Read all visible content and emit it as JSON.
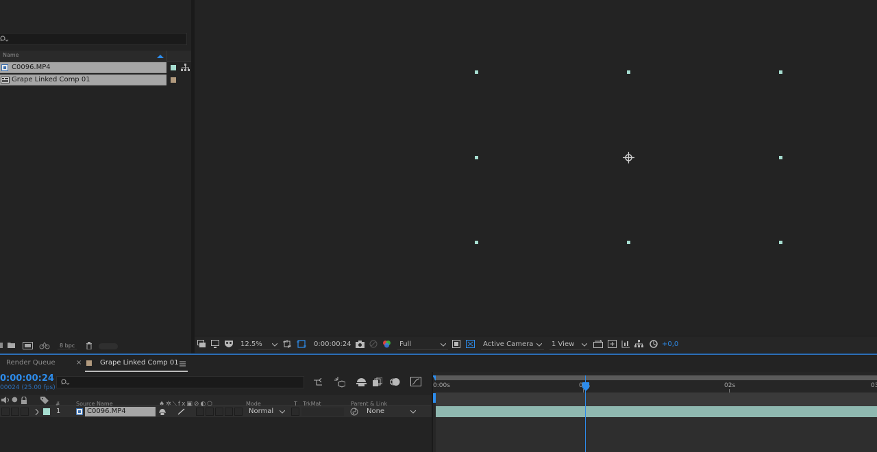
{
  "project": {
    "column_name": "Name",
    "items": [
      {
        "name": "C0096.MP4",
        "label_color": "#a6ddd0",
        "icon": "footage-icon"
      },
      {
        "name": "Grape  Linked Comp 01",
        "label_color": "#b29a7e",
        "icon": "composition-icon"
      }
    ],
    "footer": {
      "bpc": "8 bpc"
    }
  },
  "viewer": {
    "toolbar": {
      "zoom": "12.5%",
      "timecode": "0:00:00:24",
      "resolution": "Full",
      "camera": "Active Camera",
      "views": "1 View",
      "exposure": "+0,0"
    }
  },
  "timeline": {
    "tabs": [
      {
        "label": "Render Queue",
        "active": false
      },
      {
        "label": "Grape  Linked Comp 01",
        "active": true,
        "label_color": "#b29a7e"
      }
    ],
    "current_time": "0:00:00:24",
    "frame_info": "00024 (25.00 fps)",
    "columns": {
      "label": "#",
      "source_name": "Source Name",
      "mode": "Mode",
      "t": "T",
      "trkmat": "TrkMat",
      "parent": "Parent & Link"
    },
    "ruler": [
      "0:00s",
      "01s",
      "02s",
      "03"
    ],
    "playhead_fraction": 0.34,
    "layers": [
      {
        "index": "1",
        "source_name": "C0096.MP4",
        "mode": "Normal",
        "parent": "None",
        "label_color": "#a6ddd0"
      }
    ]
  },
  "colors": {
    "accent": "#2d8ceb",
    "footage_label": "#a6ddd0",
    "comp_label": "#b29a7e"
  }
}
